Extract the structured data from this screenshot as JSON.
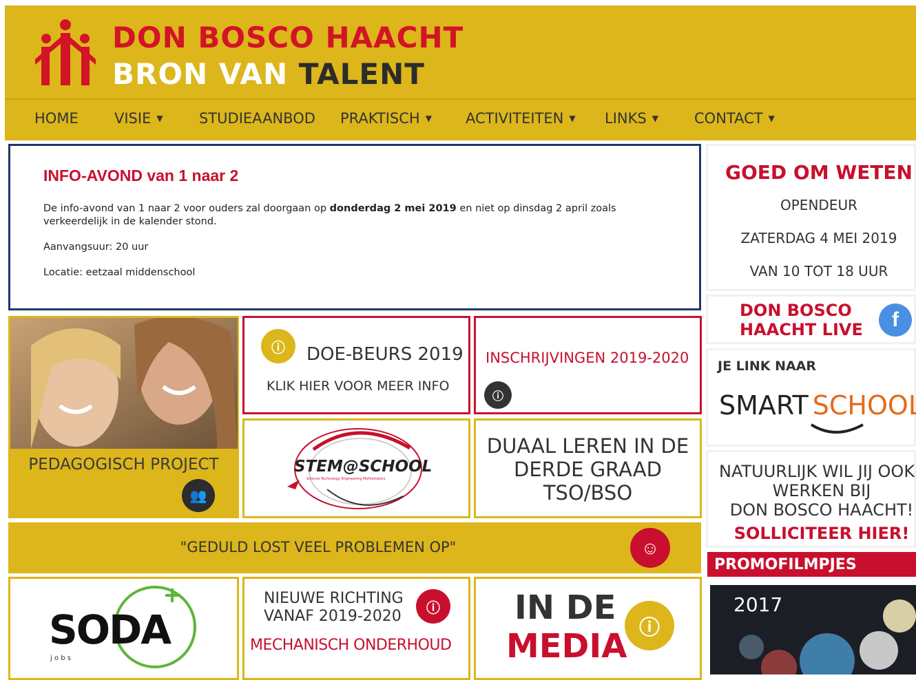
{
  "header": {
    "logo_line1": "DON BOSCO HAACHT",
    "logo_line2_a": "BRON VAN",
    "logo_line2_b": "TALENT"
  },
  "nav": [
    {
      "label": "HOME",
      "dropdown": false
    },
    {
      "label": "VISIE",
      "dropdown": true
    },
    {
      "label": "STUDIEAANBOD",
      "dropdown": false
    },
    {
      "label": "PRAKTISCH",
      "dropdown": true
    },
    {
      "label": "ACTIVITEITEN",
      "dropdown": true
    },
    {
      "label": "LINKS",
      "dropdown": true
    },
    {
      "label": "CONTACT",
      "dropdown": true
    }
  ],
  "info": {
    "title": "INFO-AVOND van 1 naar 2",
    "p1_a": "De info-avond van 1 naar 2 voor ouders zal doorgaan op ",
    "p1_bold": "donderdag 2 mei 2019",
    "p1_b": " en niet op dinsdag 2 april zoals",
    "p1_c": "verkeerdelijk in de kalender stond.",
    "p2": "Aanvangsuur: 20 uur",
    "p3": "Locatie: eetzaal middenschool"
  },
  "tiles": {
    "pedagogisch": "PEDAGOGISCH PROJECT",
    "doe_beurs_title": "DOE-BEURS 2019",
    "doe_beurs_sub": "KLIK HIER VOOR MEER INFO",
    "inschrijvingen": "INSCHRIJVINGEN 2019-2020",
    "stem_logo": "STEM@SCHOOL",
    "stem_sub": "Science Technology Engineering Mathematics",
    "duaal_1": "DUAAL LEREN IN DE",
    "duaal_2": "DERDE GRAAD",
    "duaal_3": "TSO/BSO",
    "quote": "\"GEDULD LOST VEEL PROBLEMEN OP\"",
    "soda_logo": "SODA",
    "soda_sub": "j o b s",
    "nieuwe_1": "NIEUWE RICHTING",
    "nieuwe_2": "VANAF 2019-2020",
    "nieuwe_3": "MECHANISCH ONDERHOUD",
    "media_1": "IN DE",
    "media_2": "MEDIA"
  },
  "sidebar": {
    "goed_title": "GOED OM WETEN",
    "goed_1": "OPENDEUR",
    "goed_2": "ZATERDAG 4 MEI 2019",
    "goed_3": "VAN 10 TOT 18 UUR",
    "live_1": "DON BOSCO",
    "live_2": "HAACHT LIVE",
    "smart_label": "JE LINK NAAR",
    "smart_a": "SMART",
    "smart_b": "SCHOOL",
    "werk_1": "NATUURLIJK WIL JIJ OOK",
    "werk_2": "WERKEN BIJ",
    "werk_3": "DON BOSCO HAACHT!",
    "werk_4": "SOLLICITEER HIER!",
    "promo_title": "PROMOFILMPJES",
    "promo_year": "2017"
  },
  "colors": {
    "gold": "#dcb61a",
    "red": "#c8102e",
    "navy": "#1f3766"
  }
}
